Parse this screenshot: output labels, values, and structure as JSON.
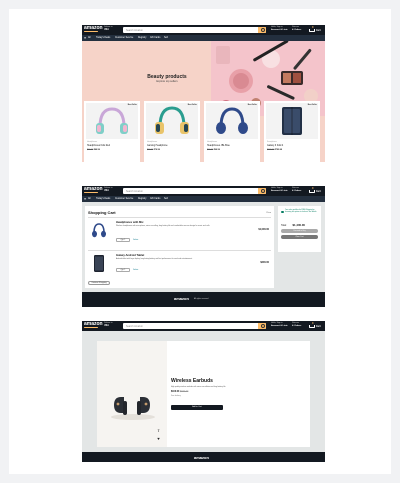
{
  "nav": {
    "logo": "amazon",
    "deliver_to": "Deliver to",
    "deliver_loc": "USA",
    "search_placeholder": "Search Amazon",
    "account_top": "Hello, Sign in",
    "account_bottom": "Account & Lists",
    "orders_top": "Returns",
    "orders_bottom": "& Orders",
    "cart_count": "0",
    "cart_label": "Cart"
  },
  "subnav": [
    "All",
    "Today's Deals",
    "Customer Service",
    "Registry",
    "Gift Cards",
    "Sell"
  ],
  "home": {
    "hero_title": "Beauty products",
    "hero_subtitle": "Explore top sellers",
    "products": [
      {
        "badge": "Best Seller",
        "category": "Headphones",
        "name": "Headphones Kids Red",
        "price": "$49.99",
        "old_price": "$99.99"
      },
      {
        "badge": "Best Seller",
        "category": "Headphones",
        "name": "Gaming Headphone",
        "price": "$79.99",
        "old_price": "$99.99"
      },
      {
        "badge": "Best Seller",
        "category": "Headphones",
        "name": "Headphones JBL Blue",
        "price": "$99.99",
        "old_price": "$99.99"
      },
      {
        "badge": "Best Seller",
        "category": "Smartphone",
        "name": "Galaxy Z Fold 4",
        "price": "$799.99",
        "old_price": "$999.99"
      }
    ]
  },
  "cart": {
    "title": "Shopping Cart",
    "price_header": "Price",
    "items": [
      {
        "name": "Headphones with Mic",
        "desc": "Wireless headphones with microphone, noise cancelling, long battery life and comfortable over-ear design for music and calls.",
        "qty": "Qty: 1",
        "delete": "Delete",
        "price": "$1,000.00"
      },
      {
        "name": "Galaxy Android Tablet",
        "desc": "Android tablet with large display, long-lasting battery and fast performance for work and entertainment.",
        "qty": "Qty: 1",
        "delete": "Delete",
        "price": "$200.00"
      }
    ],
    "continue_label": "Continue Shopping",
    "free_ship": "Your order qualifies for FREE Shipping by choosing this option at checkout. See details",
    "total_label": "Total:",
    "total": "$1,400.00",
    "checkout_label": "Proceed to Buy",
    "clear_label": "Clear Cart",
    "footer_logo": "amazon",
    "footer_copy": "All rights reserved"
  },
  "detail": {
    "title": "Wireless Earbuds",
    "desc": "High quality wireless earbuds with noise cancellation and long battery life.",
    "price": "$100.00",
    "old_price": "$150.00",
    "installment": "Free delivery",
    "add_label": "Add to Cart",
    "footer_logo": "amazon"
  }
}
